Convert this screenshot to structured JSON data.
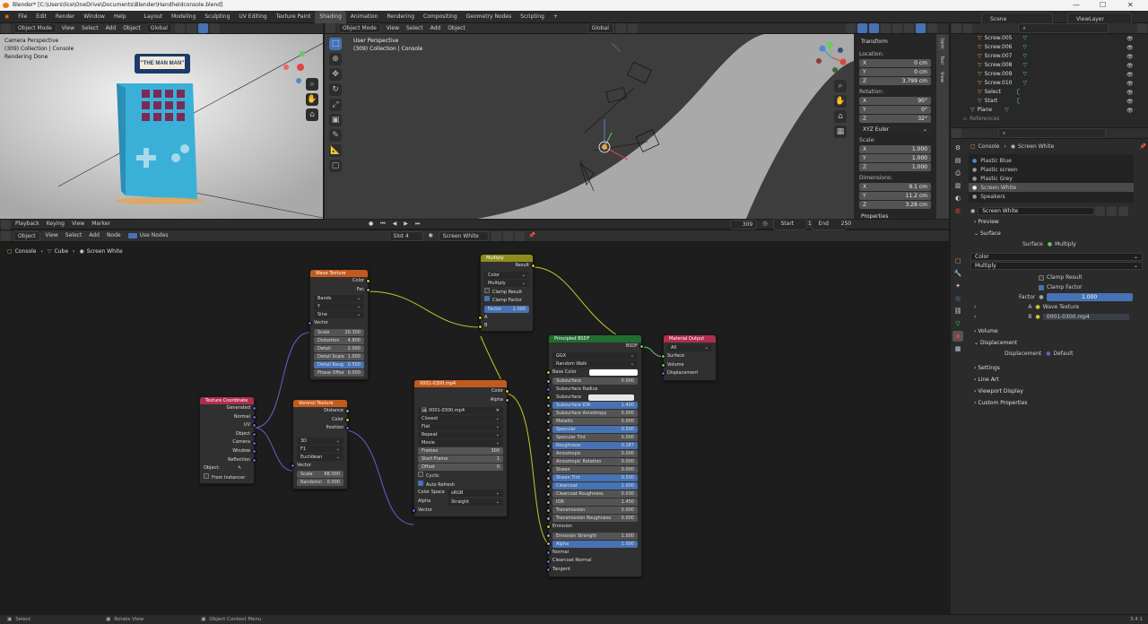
{
  "window": {
    "title": "Blender* [C:\\Users\\lice\\OneDrive\\Documents\\Blender\\Handheldconsole.blend]"
  },
  "menu": [
    "File",
    "Edit",
    "Render",
    "Window",
    "Help"
  ],
  "workspaces": [
    "Layout",
    "Modeling",
    "Sculpting",
    "UV Editing",
    "Texture Paint",
    "Shading",
    "Animation",
    "Rendering",
    "Compositing",
    "Geometry Nodes",
    "Scripting",
    "+"
  ],
  "active_workspace": "Shading",
  "scene": "Scene",
  "view_layer": "ViewLayer",
  "left_viewport": {
    "menus": [
      "Object Mode",
      "View",
      "Select",
      "Add",
      "Object"
    ],
    "orientation": "Global",
    "overlay_title": "Camera Perspective",
    "overlay_collection": "(309) Collection | Console",
    "overlay_status": "Rendering Done",
    "console_label": "\"THE MAN MAN\""
  },
  "main_viewport": {
    "menus": [
      "Object Mode",
      "View",
      "Select",
      "Add",
      "Object"
    ],
    "orientation": "Global",
    "overlay_title": "User Perspective",
    "overlay_collection": "(309) Collection | Console"
  },
  "npanel": {
    "tabs": [
      "Item",
      "Tool",
      "View"
    ],
    "transform": "Transform",
    "location_label": "Location:",
    "location": [
      {
        "a": "X",
        "v": "0 cm"
      },
      {
        "a": "Y",
        "v": "0 cm"
      },
      {
        "a": "Z",
        "v": "3.799 cm"
      }
    ],
    "rotation_label": "Rotation:",
    "rotation": [
      {
        "a": "X",
        "v": "90°"
      },
      {
        "a": "Y",
        "v": "0°"
      },
      {
        "a": "Z",
        "v": "32°"
      }
    ],
    "rotation_mode": "XYZ Euler",
    "scale_label": "Scale:",
    "scale": [
      {
        "a": "X",
        "v": "1.000"
      },
      {
        "a": "Y",
        "v": "1.000"
      },
      {
        "a": "Z",
        "v": "1.000"
      }
    ],
    "dimensions_label": "Dimensions:",
    "dimensions": [
      {
        "a": "X",
        "v": "9.1 cm"
      },
      {
        "a": "Y",
        "v": "11.2 cm"
      },
      {
        "a": "Z",
        "v": "3.28 cm"
      }
    ],
    "properties": "Properties"
  },
  "outliner": {
    "items": [
      "Screw.005",
      "Screw.006",
      "Screw.007",
      "Screw.008",
      "Screw.009",
      "Screw.010",
      "Select",
      "Start",
      "Plane",
      "References"
    ]
  },
  "timeline": {
    "menus": [
      "Playback",
      "Keying",
      "View",
      "Marker"
    ],
    "frame": "309",
    "start_label": "Start",
    "start": "1",
    "end_label": "End",
    "end": "250"
  },
  "node_editor": {
    "menus": [
      "Object",
      "View",
      "Select",
      "Add",
      "Node"
    ],
    "use_nodes": "Use Nodes",
    "slot": "Slot 4",
    "material": "Screen White",
    "breadcrumb": [
      "Console",
      "Cube",
      "Screen White"
    ]
  },
  "nodes": {
    "wave": {
      "title": "Wave Texture",
      "out": [
        "Color",
        "Fac"
      ],
      "dd": [
        "Bands",
        "Y",
        "Sine"
      ],
      "vector": "Vector",
      "fields": [
        {
          "k": "Scale",
          "v": "20.300"
        },
        {
          "k": "Distortion",
          "v": "4.800"
        },
        {
          "k": "Detail",
          "v": "2.000"
        },
        {
          "k": "Detail Scale",
          "v": "1.000"
        },
        {
          "k": "Detail Roug",
          "v": "0.500"
        },
        {
          "k": "Phase Offse",
          "v": "0.000"
        }
      ]
    },
    "multiply": {
      "title": "Multiply",
      "out": "Result",
      "dd": [
        "Color",
        "Multiply"
      ],
      "clamp_result": "Clamp Result",
      "clamp_factor": "Clamp Factor",
      "factor_label": "Factor",
      "factor": "1.000",
      "a": "A",
      "b": "B"
    },
    "texcoord": {
      "title": "Texture Coordinate",
      "out": [
        "Generated",
        "Normal",
        "UV",
        "Object",
        "Camera",
        "Window",
        "Reflection"
      ],
      "object_label": "Object:",
      "from_instancer": "From Instancer"
    },
    "voronoi": {
      "title": "Voronoi Texture",
      "out": [
        "Distance",
        "Color",
        "Position"
      ],
      "dd": [
        "3D",
        "F1",
        "Euclidean"
      ],
      "vector": "Vector",
      "fields": [
        {
          "k": "Scale",
          "v": "68.000"
        },
        {
          "k": "Randomn",
          "v": "0.000"
        }
      ]
    },
    "image": {
      "title": "0001-0300.mp4",
      "out": [
        "Color",
        "Alpha"
      ],
      "file": "0001-0300.mp4",
      "dd": [
        "Closest",
        "Flat",
        "Repeat",
        "Movie"
      ],
      "fields": [
        {
          "k": "Frames",
          "v": "300"
        },
        {
          "k": "Start Frame",
          "v": "1"
        },
        {
          "k": "Offset",
          "v": "0"
        }
      ],
      "cyclic": "Cyclic",
      "auto_refresh": "Auto Refresh",
      "color_space_label": "Color Space",
      "color_space": "sRGB",
      "alpha_label": "Alpha",
      "alpha": "Straight",
      "vector": "Vector"
    },
    "bsdf": {
      "title": "Principled BSDF",
      "out": "BSDF",
      "dd": [
        "GGX",
        "Random Walk"
      ],
      "base_color": "Base Color",
      "rows": [
        {
          "k": "Subsurface",
          "v": "0.000"
        },
        {
          "k": "Subsurface Radius",
          "v": ""
        },
        {
          "k": "Subsurface C...",
          "v": ""
        },
        {
          "k": "Subsurface IOR",
          "v": "1.400",
          "b": 1
        },
        {
          "k": "Subsurface Anisotropy",
          "v": "0.000"
        },
        {
          "k": "Metallic",
          "v": "0.000"
        },
        {
          "k": "Specular",
          "v": "0.500",
          "b": 1
        },
        {
          "k": "Specular Tint",
          "v": "0.000"
        },
        {
          "k": "Roughness",
          "v": "0.187",
          "b": 1
        },
        {
          "k": "Anisotropic",
          "v": "0.000"
        },
        {
          "k": "Anisotropic Rotation",
          "v": "0.000"
        },
        {
          "k": "Sheen",
          "v": "0.000"
        },
        {
          "k": "Sheen Tint",
          "v": "0.500",
          "b": 1
        },
        {
          "k": "Clearcoat",
          "v": "1.000",
          "b": 1
        },
        {
          "k": "Clearcoat Roughness",
          "v": "0.030"
        },
        {
          "k": "IOR",
          "v": "1.450"
        },
        {
          "k": "Transmission",
          "v": "0.000"
        },
        {
          "k": "Transmission Roughness",
          "v": "0.000"
        }
      ],
      "emission": "Emission",
      "emission_strength": {
        "k": "Emission Strength",
        "v": "1.000"
      },
      "alpha": {
        "k": "Alpha",
        "v": "1.000"
      },
      "tail": [
        "Normal",
        "Clearcoat Normal",
        "Tangent"
      ]
    },
    "output": {
      "title": "Material Output",
      "target": "All",
      "in": [
        "Surface",
        "Volume",
        "Displacement"
      ]
    }
  },
  "properties_editor": {
    "breadcrumb": [
      "Console",
      "Screen White"
    ],
    "materials": [
      "Plastic Blue",
      "Plastic screen",
      "Plastic Grey",
      "Screen White",
      "Speakers"
    ],
    "active_material": "Screen White",
    "material_name": "Screen White",
    "preview": "Preview",
    "surface_section": "Surface",
    "surface_label": "Surface",
    "surface_value": "Multiply",
    "dd1": "Color",
    "dd2": "Multiply",
    "clamp_result": "Clamp Result",
    "clamp_factor": "Clamp Factor",
    "factor_label": "Factor",
    "factor": "1.000",
    "a_label": "A",
    "a_value": "Wave Texture",
    "b_label": "B",
    "b_value": "0001-0300.mp4",
    "volume": "Volume",
    "displacement_section": "Displacement",
    "displacement_label": "Displacement",
    "displacement_value": "Default",
    "sections": [
      "Settings",
      "Line Art",
      "Viewport Display",
      "Custom Properties"
    ]
  },
  "statusbar": {
    "items": [
      "Select",
      "Rotate View",
      "Object Context Menu"
    ],
    "version": "3.4.1"
  }
}
